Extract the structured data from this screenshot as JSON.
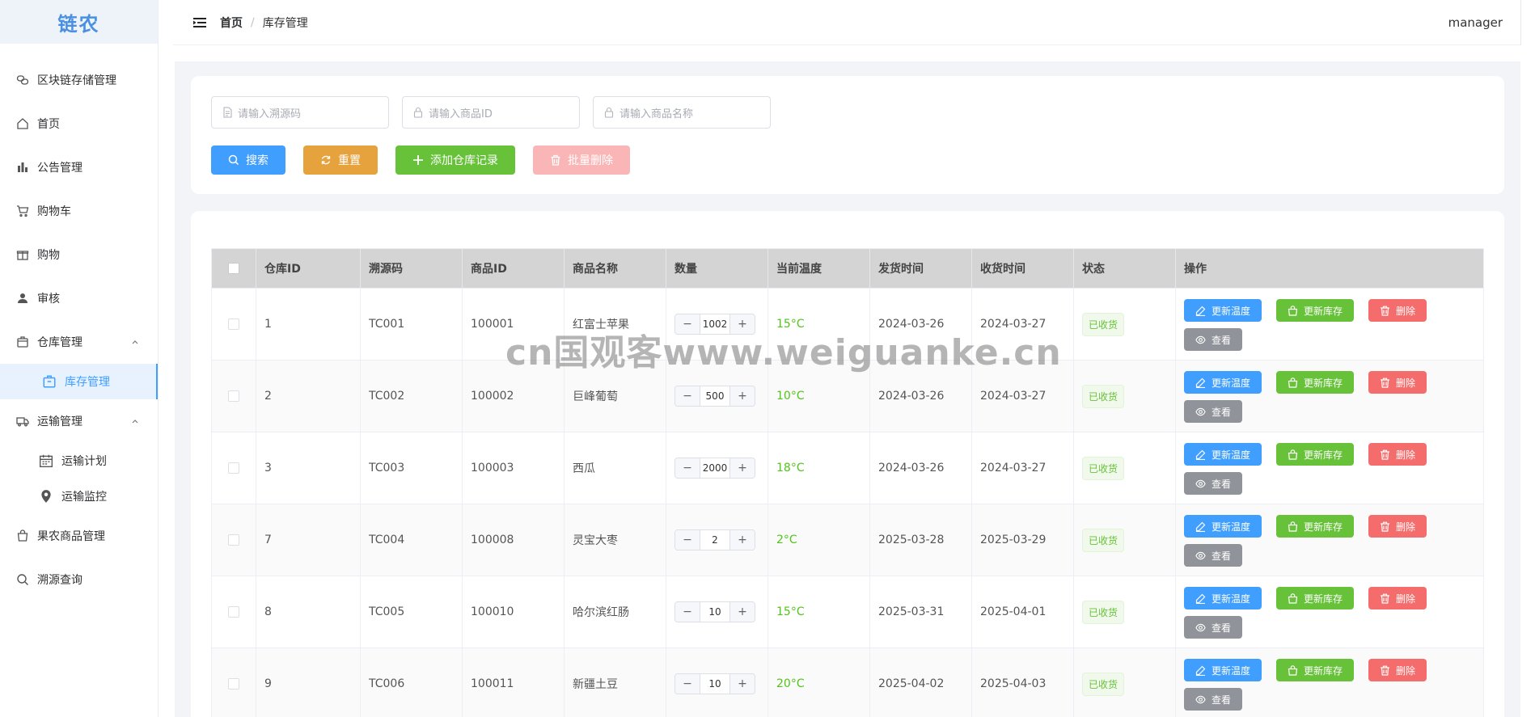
{
  "app": {
    "logo": "链农"
  },
  "sidebar": {
    "items": [
      {
        "label": "区块链存储管理",
        "icon": "chain-icon"
      },
      {
        "label": "首页",
        "icon": "home-icon"
      },
      {
        "label": "公告管理",
        "icon": "bar-chart-icon"
      },
      {
        "label": "购物车",
        "icon": "cart-icon"
      },
      {
        "label": "购物",
        "icon": "gift-icon"
      },
      {
        "label": "审核",
        "icon": "user-icon"
      },
      {
        "label": "仓库管理",
        "icon": "box-icon"
      },
      {
        "label": "运输管理",
        "icon": "truck-icon"
      },
      {
        "label": "果农商品管理",
        "icon": "bag-icon"
      },
      {
        "label": "溯源查询",
        "icon": "search-icon"
      }
    ],
    "warehouse_sub": [
      {
        "label": "库存管理",
        "icon": "box-icon"
      }
    ],
    "transport_sub": [
      {
        "label": "运输计划",
        "icon": "calendar-icon"
      },
      {
        "label": "运输监控",
        "icon": "location-icon"
      }
    ]
  },
  "header": {
    "breadcrumb_home": "首页",
    "breadcrumb_sep": "/",
    "breadcrumb_current": "库存管理",
    "user": "manager"
  },
  "search": {
    "trace_placeholder": "请输入溯源码",
    "product_id_placeholder": "请输入商品ID",
    "product_name_placeholder": "请输入商品名称",
    "search_label": "搜索",
    "reset_label": "重置",
    "add_label": "添加仓库记录",
    "batch_delete_label": "批量删除"
  },
  "table": {
    "headers": [
      "仓库ID",
      "溯源码",
      "商品ID",
      "商品名称",
      "数量",
      "当前温度",
      "发货时间",
      "收货时间",
      "状态",
      "操作"
    ],
    "rows": [
      {
        "id": "1",
        "trace": "TC001",
        "pid": "100001",
        "name": "红富士苹果",
        "qty": "1002",
        "temp": "15°C",
        "ship": "2024-03-26",
        "recv": "2024-03-27",
        "status": "已收货"
      },
      {
        "id": "2",
        "trace": "TC002",
        "pid": "100002",
        "name": "巨峰葡萄",
        "qty": "500",
        "temp": "10°C",
        "ship": "2024-03-26",
        "recv": "2024-03-27",
        "status": "已收货"
      },
      {
        "id": "3",
        "trace": "TC003",
        "pid": "100003",
        "name": "西瓜",
        "qty": "2000",
        "temp": "18°C",
        "ship": "2024-03-26",
        "recv": "2024-03-27",
        "status": "已收货"
      },
      {
        "id": "7",
        "trace": "TC004",
        "pid": "100008",
        "name": "灵宝大枣",
        "qty": "2",
        "temp": "2°C",
        "ship": "2025-03-28",
        "recv": "2025-03-29",
        "status": "已收货"
      },
      {
        "id": "8",
        "trace": "TC005",
        "pid": "100010",
        "name": "哈尔滨红肠",
        "qty": "10",
        "temp": "15°C",
        "ship": "2025-03-31",
        "recv": "2025-04-01",
        "status": "已收货"
      },
      {
        "id": "9",
        "trace": "TC006",
        "pid": "100011",
        "name": "新疆土豆",
        "qty": "10",
        "temp": "20°C",
        "ship": "2025-04-02",
        "recv": "2025-04-03",
        "status": "已收货"
      }
    ],
    "actions": {
      "update_temp": "更新温度",
      "update_stock": "更新库存",
      "delete": "删除",
      "view": "查看"
    },
    "stepper": {
      "minus": "−",
      "plus": "+"
    }
  },
  "watermark": "cn国观客www.weiguanke.cn",
  "colors": {
    "primary": "#409eff",
    "warning": "#e6a23c",
    "success": "#67c23a",
    "danger": "#f56c6c",
    "info": "#909399"
  }
}
